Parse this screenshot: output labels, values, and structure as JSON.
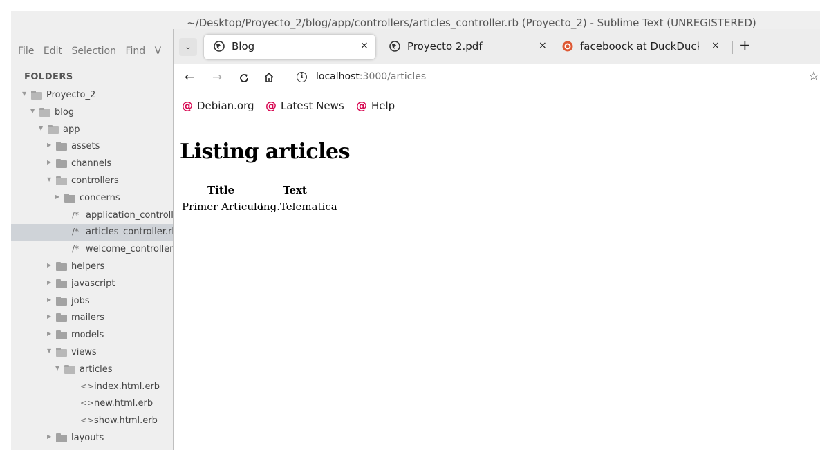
{
  "sublime": {
    "title": "~/Desktop/Proyecto_2/blog/app/controllers/articles_controller.rb (Proyecto_2) - Sublime Text (UNREGISTERED)",
    "menu": [
      "File",
      "Edit",
      "Selection",
      "Find",
      "V"
    ],
    "folders_label": "FOLDERS",
    "tree": [
      {
        "label": "Proyecto_2",
        "kind": "folder-open"
      },
      {
        "label": "blog",
        "kind": "folder-open"
      },
      {
        "label": "app",
        "kind": "folder-open"
      },
      {
        "label": "assets",
        "kind": "folder-closed"
      },
      {
        "label": "channels",
        "kind": "folder-closed"
      },
      {
        "label": "controllers",
        "kind": "folder-open"
      },
      {
        "label": "concerns",
        "kind": "folder-closed"
      },
      {
        "label": "application_controll",
        "kind": "file-code",
        "tag": "/*"
      },
      {
        "label": "articles_controller.rb",
        "kind": "file-code",
        "tag": "/*",
        "selected": true
      },
      {
        "label": "welcome_controller.",
        "kind": "file-code",
        "tag": "/*"
      },
      {
        "label": "helpers",
        "kind": "folder-closed"
      },
      {
        "label": "javascript",
        "kind": "folder-closed"
      },
      {
        "label": "jobs",
        "kind": "folder-closed"
      },
      {
        "label": "mailers",
        "kind": "folder-closed"
      },
      {
        "label": "models",
        "kind": "folder-closed"
      },
      {
        "label": "views",
        "kind": "folder-open"
      },
      {
        "label": "articles",
        "kind": "folder-open"
      },
      {
        "label": "index.html.erb",
        "kind": "file-markup",
        "tag": "<>"
      },
      {
        "label": "new.html.erb",
        "kind": "file-markup",
        "tag": "<>"
      },
      {
        "label": "show.html.erb",
        "kind": "file-markup",
        "tag": "<>"
      },
      {
        "label": "layouts",
        "kind": "folder-closed"
      }
    ]
  },
  "browser": {
    "tabs": [
      {
        "label": "Blog",
        "icon": "globe-icon",
        "active": true
      },
      {
        "label": "Proyecto 2.pdf",
        "icon": "globe-icon",
        "active": false
      },
      {
        "label": "faceboock at DuckDuckG",
        "icon": "duckduckgo-icon",
        "active": false
      }
    ],
    "tab_list_glyph": "⌄",
    "close_glyph": "×",
    "new_tab_glyph": "+",
    "url_host": "localhost",
    "url_path": ":3000/articles",
    "bookmarks": [
      "Debian.org",
      "Latest News",
      "Help"
    ]
  },
  "page": {
    "heading": "Listing articles",
    "table": {
      "headers": [
        "Title",
        "Text"
      ],
      "rows": [
        [
          "Primer Articulo",
          "Ing.Telematica"
        ]
      ]
    }
  },
  "colors": {
    "debian_red": "#d70751",
    "duckduckgo_orange": "#de5833",
    "sidebar_bg": "#efefef",
    "selection": "#cfd3d8"
  }
}
